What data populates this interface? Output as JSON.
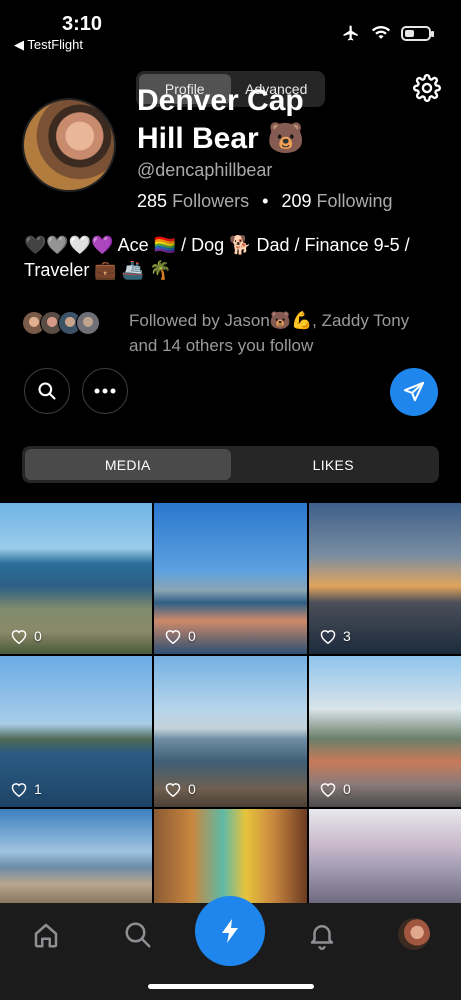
{
  "status_bar": {
    "time": "3:10",
    "back_app": "◀ TestFlight"
  },
  "header": {
    "tabs": [
      {
        "label": "Profile",
        "active": true
      },
      {
        "label": "Advanced",
        "active": false
      }
    ]
  },
  "profile": {
    "display_name": "Denver Cap Hill Bear 🐻",
    "handle": "@dencaphillbear",
    "followers_count": "285",
    "followers_label": "Followers",
    "separator": "•",
    "following_count": "209",
    "following_label": "Following",
    "bio": "🖤🩶🤍💜 Ace 🏳️‍🌈 / Dog 🐕 Dad / Finance 9-5 / Traveler 💼 🚢 🌴",
    "followed_by": "Followed by  Jason🐻💪, Zaddy Tony and 14 others you follow"
  },
  "media_tabs": [
    {
      "label": "MEDIA",
      "active": true
    },
    {
      "label": "LIKES",
      "active": false
    }
  ],
  "posts": [
    {
      "likes": "0"
    },
    {
      "likes": "0"
    },
    {
      "likes": "3"
    },
    {
      "likes": "1"
    },
    {
      "likes": "0"
    },
    {
      "likes": "0"
    },
    {
      "likes": ""
    },
    {
      "likes": ""
    },
    {
      "likes": ""
    }
  ],
  "colors": {
    "accent": "#1f86ee",
    "background": "#000000",
    "muted_text": "#9a9a9a"
  },
  "icons": [
    "airplane-icon",
    "wifi-icon",
    "battery-icon",
    "gear-icon",
    "search-icon",
    "more-icon",
    "send-icon",
    "heart-icon",
    "home-icon",
    "search-nav-icon",
    "bolt-icon",
    "bell-icon"
  ]
}
